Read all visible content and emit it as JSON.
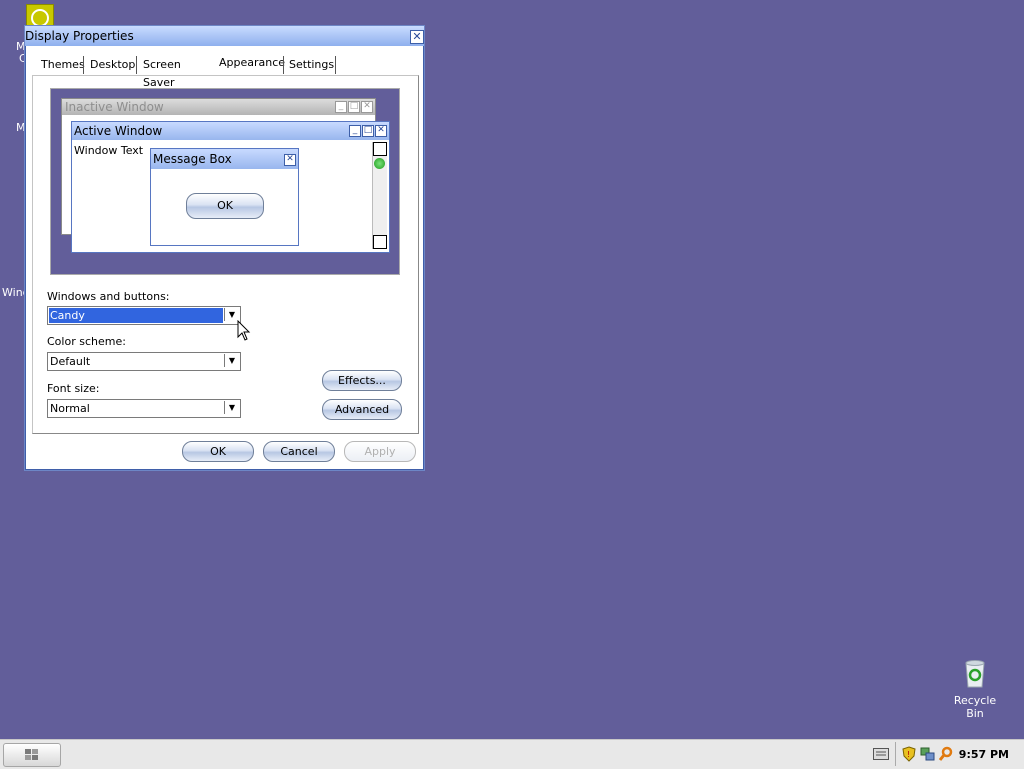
{
  "desktop": {
    "recycle_bin_label": "Recycle Bin",
    "fragments": [
      "M",
      "C",
      "M",
      "Wind"
    ]
  },
  "dialog": {
    "title": "Display Properties",
    "tabs": [
      "Themes",
      "Desktop",
      "Screen Saver",
      "Appearance",
      "Settings"
    ],
    "active_tab": "Appearance",
    "preview": {
      "inactive_title": "Inactive Window",
      "active_title": "Active Window",
      "window_text": "Window Text",
      "message_box_title": "Message Box",
      "message_box_ok": "OK"
    },
    "fields": {
      "windows_label": "Windows and buttons:",
      "windows_value": "Candy",
      "color_label": "Color scheme:",
      "color_value": "Default",
      "font_label": "Font size:",
      "font_value": "Normal"
    },
    "buttons": {
      "effects": "Effects...",
      "advanced": "Advanced",
      "ok": "OK",
      "cancel": "Cancel",
      "apply": "Apply"
    }
  },
  "taskbar": {
    "clock": "9:57 PM"
  }
}
